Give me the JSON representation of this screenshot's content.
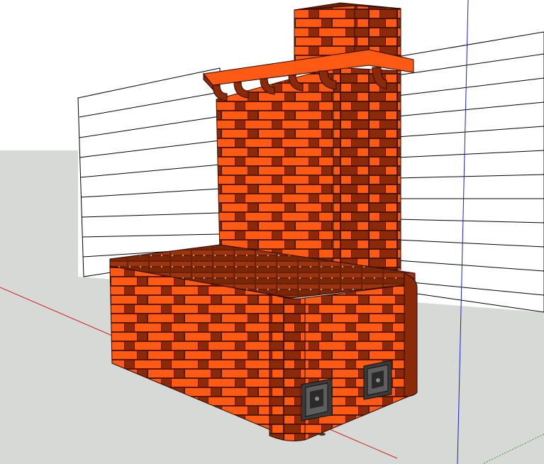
{
  "scene": {
    "model_name": "brick-stove-with-chimney",
    "sky_color": "#ffffff",
    "ground_color": "#d7d9d6",
    "brick_dark_color": "#8b2a09",
    "brick_light_color": "#ff5a14",
    "mortar_color": "#5a1804",
    "wall_stroke_color": "#000000",
    "axis_red_color": "#d02020",
    "axis_blue_color": "#1a22c8",
    "axis_green_color": "#2f9a3a",
    "door_count": 2
  }
}
